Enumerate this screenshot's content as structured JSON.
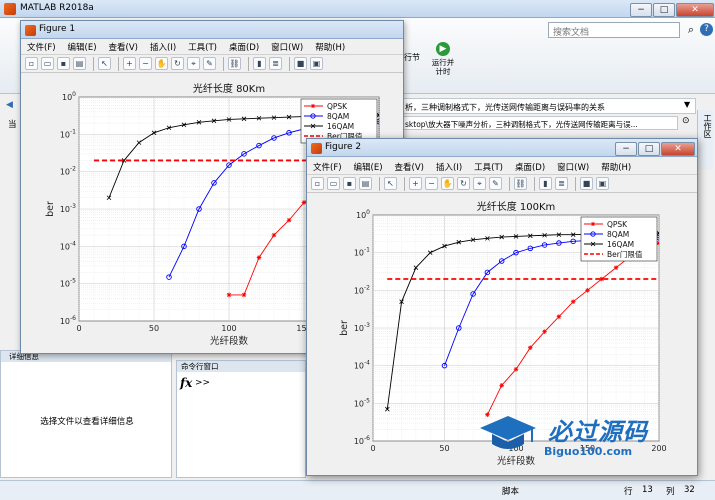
{
  "matlab": {
    "title": "MATLAB R2018a",
    "search_placeholder": "搜索文档",
    "ribbon_btn1": "行节",
    "ribbon_btn2": "运行并\n计时",
    "editor_tab_1": "析，三种调制格式下，光传送网传输距离与误码率的关系",
    "path_text": "sktop\\放大器下噪声分析，三种调制格式下，光传送网传输距离与误...",
    "workspace_label": "工作区",
    "left_label": "当",
    "details_title": "详细信息",
    "details_hint": "选择文件以查看详细信息",
    "cmd_title": "命令行窗口",
    "fx": "fx",
    "prompt": ">>",
    "status_script": "脚本",
    "status_row_label": "行",
    "status_row": "13",
    "status_col_label": "列",
    "status_col": "32"
  },
  "menu_items": [
    "文件(F)",
    "编辑(E)",
    "查看(V)",
    "插入(I)",
    "工具(T)",
    "桌面(D)",
    "窗口(W)",
    "帮助(H)"
  ],
  "figure1": {
    "title": "Figure 1"
  },
  "figure2": {
    "title": "Figure 2"
  },
  "watermark": {
    "main": "必过源码",
    "sub": "Biguo100.com"
  },
  "chart_data": [
    {
      "type": "line",
      "title": "光纤长度 80Km",
      "xlabel": "光纤段数",
      "ylabel": "ber",
      "yscale": "log",
      "ylim": [
        1e-06,
        1
      ],
      "xlim": [
        0,
        200
      ],
      "xticks": [
        0,
        50,
        100,
        150
      ],
      "yticks": [
        "10-6",
        "10-5",
        "10-4",
        "10-3",
        "10-2",
        "10-1",
        "100"
      ],
      "grid": true,
      "legend_placement": "top-right",
      "series": [
        {
          "name": "QPSK",
          "color": "#ff0000",
          "marker": "star",
          "x": [
            100,
            110,
            120,
            130,
            140,
            150,
            160,
            170,
            180,
            190,
            200
          ],
          "y": [
            5e-06,
            5e-06,
            5e-05,
            0.0002,
            0.0005,
            0.0015,
            0.003,
            0.006,
            0.01,
            0.015,
            0.022
          ]
        },
        {
          "name": "8QAM",
          "color": "#0000ff",
          "marker": "circle",
          "x": [
            60,
            70,
            80,
            90,
            100,
            110,
            120,
            130,
            140,
            150,
            160,
            170,
            180,
            190,
            200
          ],
          "y": [
            1.5e-05,
            0.0001,
            0.001,
            0.005,
            0.015,
            0.03,
            0.05,
            0.08,
            0.11,
            0.14,
            0.16,
            0.18,
            0.2,
            0.21,
            0.22
          ]
        },
        {
          "name": "16QAM",
          "color": "#000000",
          "marker": "x",
          "x": [
            20,
            30,
            40,
            50,
            60,
            70,
            80,
            90,
            100,
            110,
            120,
            130,
            140,
            150,
            160,
            170,
            180,
            190,
            200
          ],
          "y": [
            0.002,
            0.02,
            0.06,
            0.11,
            0.15,
            0.18,
            0.21,
            0.23,
            0.25,
            0.26,
            0.27,
            0.28,
            0.29,
            0.3,
            0.3,
            0.31,
            0.32,
            0.32,
            0.33
          ]
        },
        {
          "name": "Ber门限值",
          "color": "#ff0000",
          "style": "dashed",
          "x": [
            10,
            200
          ],
          "y": [
            0.02,
            0.02
          ]
        }
      ]
    },
    {
      "type": "line",
      "title": "光纤长度 100Km",
      "xlabel": "光纤段数",
      "ylabel": "ber",
      "yscale": "log",
      "ylim": [
        1e-06,
        1
      ],
      "xlim": [
        0,
        200
      ],
      "xticks": [
        0,
        50,
        100,
        150,
        200
      ],
      "yticks": [
        "10-6",
        "10-5",
        "10-4",
        "10-3",
        "10-2",
        "10-1",
        "100"
      ],
      "grid": true,
      "legend_placement": "top-right",
      "series": [
        {
          "name": "QPSK",
          "color": "#ff0000",
          "marker": "star",
          "x": [
            80,
            90,
            100,
            110,
            120,
            130,
            140,
            150,
            160,
            170,
            180,
            190,
            200
          ],
          "y": [
            5e-06,
            3e-05,
            8e-05,
            0.0003,
            0.0008,
            0.002,
            0.005,
            0.01,
            0.02,
            0.04,
            0.08,
            0.13,
            0.18
          ]
        },
        {
          "name": "8QAM",
          "color": "#0000ff",
          "marker": "circle",
          "x": [
            50,
            60,
            70,
            80,
            90,
            100,
            110,
            120,
            130,
            140,
            150,
            160,
            170,
            180,
            190,
            200
          ],
          "y": [
            0.0001,
            0.001,
            0.008,
            0.03,
            0.06,
            0.1,
            0.13,
            0.16,
            0.18,
            0.2,
            0.21,
            0.22,
            0.23,
            0.24,
            0.25,
            0.25
          ]
        },
        {
          "name": "16QAM",
          "color": "#000000",
          "marker": "x",
          "x": [
            10,
            20,
            30,
            40,
            50,
            60,
            70,
            80,
            90,
            100,
            110,
            120,
            130,
            140,
            150,
            160,
            170,
            180,
            190,
            200
          ],
          "y": [
            7e-06,
            0.005,
            0.04,
            0.1,
            0.15,
            0.19,
            0.22,
            0.24,
            0.26,
            0.27,
            0.28,
            0.29,
            0.3,
            0.3,
            0.31,
            0.31,
            0.32,
            0.32,
            0.33,
            0.33
          ]
        },
        {
          "name": "Ber门限值",
          "color": "#ff0000",
          "style": "dashed",
          "x": [
            10,
            200
          ],
          "y": [
            0.02,
            0.02
          ]
        }
      ]
    }
  ]
}
